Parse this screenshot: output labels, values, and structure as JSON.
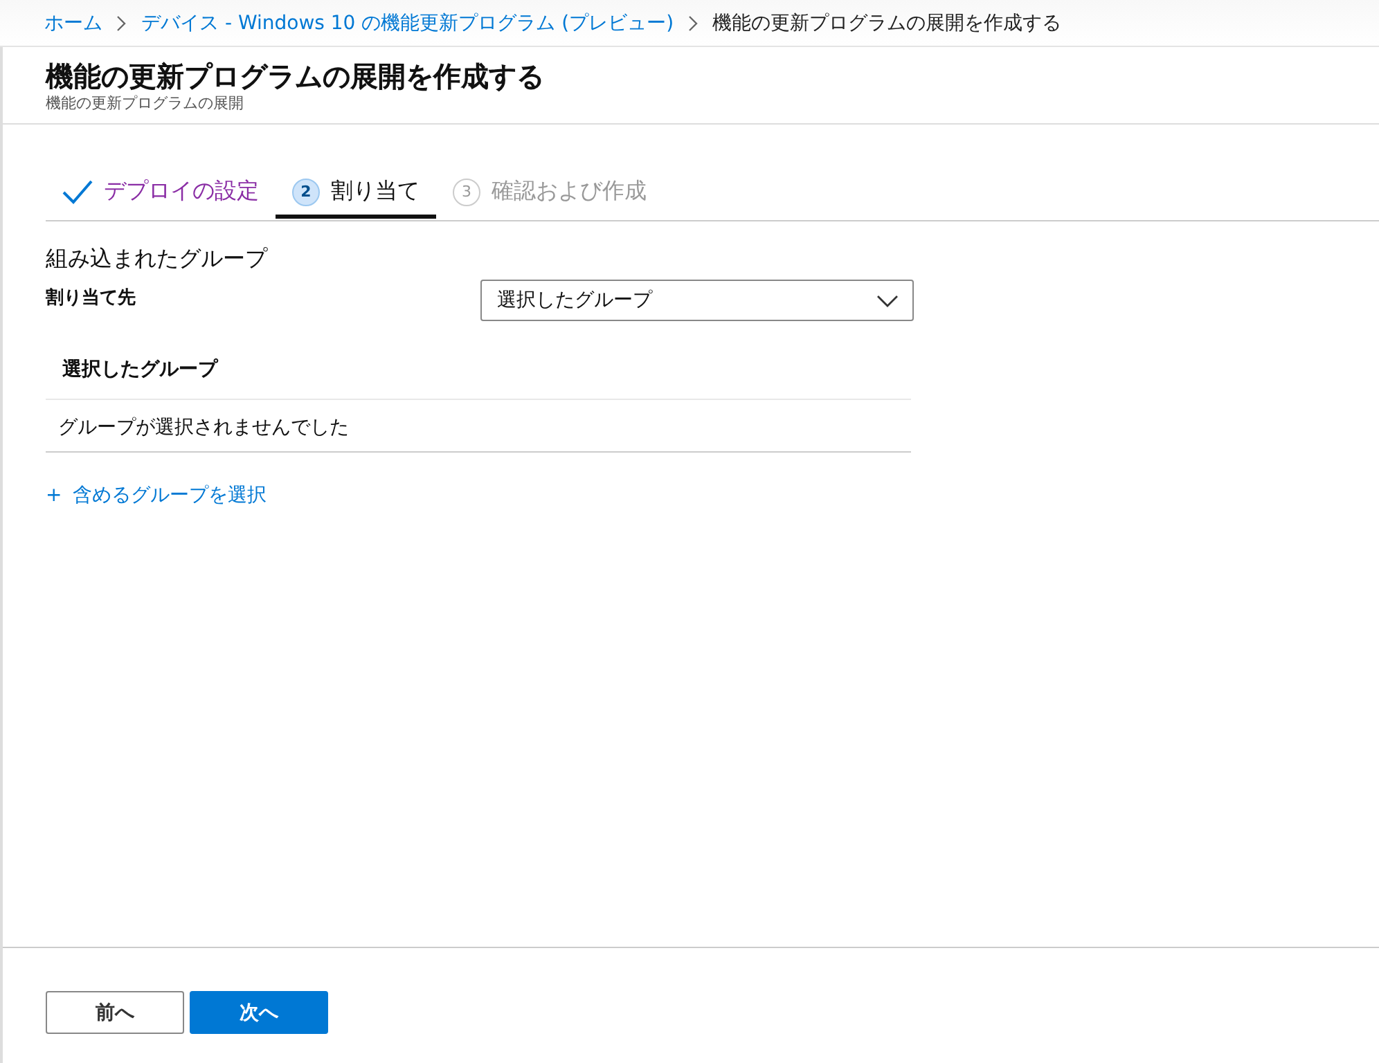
{
  "breadcrumb": [
    {
      "label": "ホーム",
      "link": true
    },
    {
      "label": "デバイス - Windows 10 の機能更新プログラム (プレビュー)",
      "link": true
    },
    {
      "label": "機能の更新プログラムの展開を作成する",
      "link": false
    }
  ],
  "header": {
    "title": "機能の更新プログラムの展開を作成する",
    "subtitle": "機能の更新プログラムの展開"
  },
  "steps": [
    {
      "kind": "done",
      "label": "デプロイの設定",
      "selected": false
    },
    {
      "kind": "current",
      "number": "2",
      "label": "割り当て",
      "selected": true
    },
    {
      "kind": "pending",
      "number": "3",
      "label": "確認および作成",
      "selected": false
    }
  ],
  "section_title": "組み込まれたグループ",
  "assign": {
    "label": "割り当て先",
    "value": "選択したグループ"
  },
  "table": {
    "header": "選択したグループ",
    "empty_text": "グループが選択されませんでした"
  },
  "add_link": {
    "icon": "+",
    "label": "含めるグループを選択"
  },
  "footer": {
    "buttons": [
      {
        "label": "前へ",
        "primary": false
      },
      {
        "label": "次へ",
        "primary": true
      }
    ]
  }
}
